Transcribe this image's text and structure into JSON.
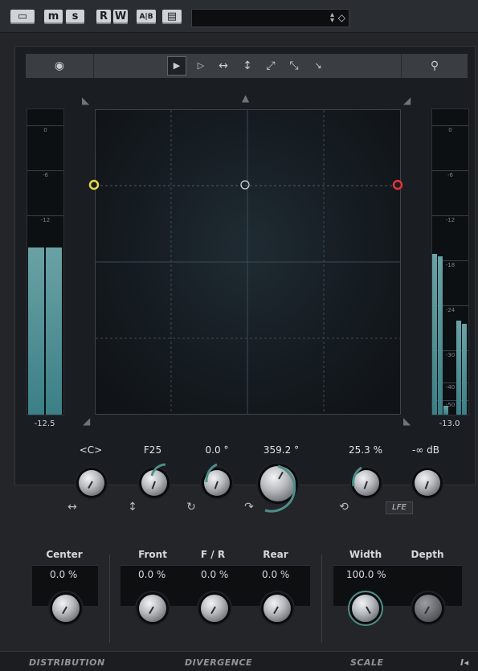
{
  "toolbar": {
    "buttons": [
      {
        "label": "▭",
        "name": "bypass-button"
      },
      {
        "label": "m",
        "name": "mute-button"
      },
      {
        "label": "s",
        "name": "solo-button"
      },
      {
        "label": "R",
        "name": "read-button"
      },
      {
        "label": "W",
        "name": "write-button"
      },
      {
        "label": "A|B",
        "name": "ab-button"
      },
      {
        "label": "▤",
        "name": "menu-button"
      }
    ],
    "preset_value": ""
  },
  "panner": {
    "tools": [
      "pointer",
      "select",
      "horizontal",
      "vertical",
      "diagonal",
      "diagonal-2",
      "pointer-alt"
    ],
    "left_meter": {
      "scale": [
        "0",
        "-6",
        "-12"
      ],
      "value": "-12.5",
      "level": 0.55
    },
    "right_meter": {
      "scale": [
        "0",
        "-6",
        "-12",
        "-18",
        "-24",
        "-30",
        "-40",
        "-50"
      ],
      "value": "-13.0",
      "levels": [
        0.53,
        0.52,
        0.03,
        0.31,
        0.3
      ]
    }
  },
  "controls": {
    "center": {
      "label": "<C>"
    },
    "format": {
      "label": "F25"
    },
    "rotation": {
      "label": "0.0 °"
    },
    "orbit": {
      "label": "359.2 °"
    },
    "divergence": {
      "label": "25.3 %"
    },
    "lfe": {
      "label": "-∞ dB",
      "badge": "LFE"
    }
  },
  "sections": {
    "center": {
      "heading": "Center",
      "value": "0.0 %"
    },
    "front": {
      "heading": "Front",
      "value": "0.0 %"
    },
    "fr": {
      "heading": "F / R",
      "value": "0.0 %"
    },
    "rear": {
      "heading": "Rear",
      "value": "0.0 %"
    },
    "width": {
      "heading": "Width",
      "value": "100.0 %"
    },
    "depth": {
      "heading": "Depth",
      "value": ""
    }
  },
  "footer": {
    "distribution": "DISTRIBUTION",
    "divergence": "DIVERGENCE",
    "scale": "SCALE",
    "end_icon": "I◂"
  }
}
